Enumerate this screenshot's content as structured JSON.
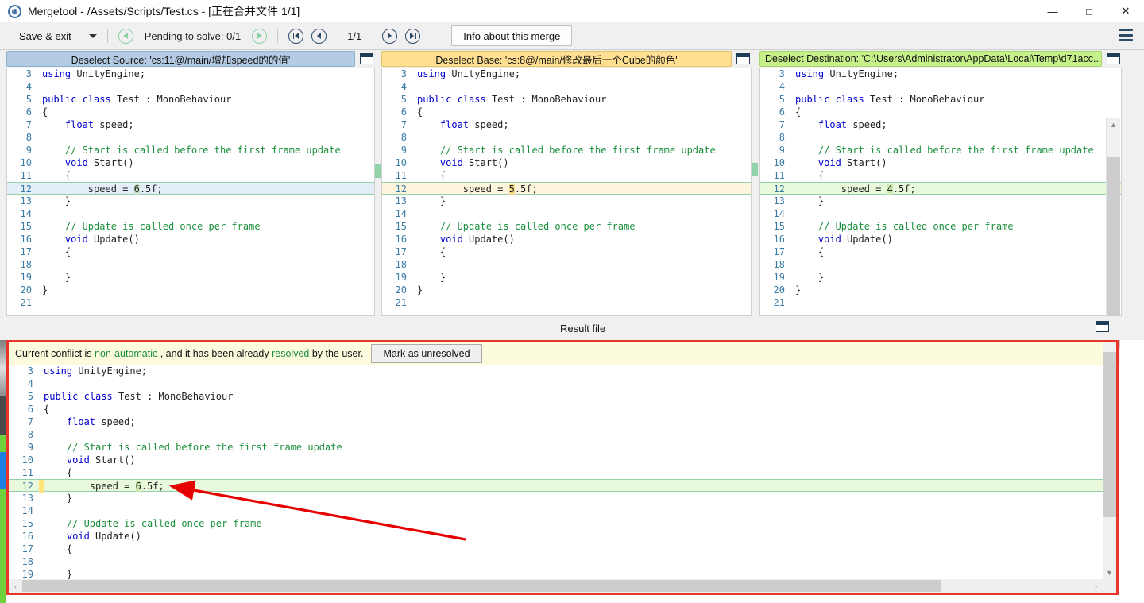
{
  "window": {
    "title": "Mergetool - /Assets/Scripts/Test.cs - [正在合并文件 1/1]",
    "logo_glyph": "◉",
    "minimize": "—",
    "maximize": "□",
    "close": "✕"
  },
  "toolbar": {
    "save_label": "Save & exit",
    "pending_label": "Pending to solve: 0/1",
    "counter": "1/1",
    "info_label": "Info about this merge",
    "prev_conflict_icon": "prev-conflict-icon",
    "next_conflict_icon": "next-conflict-icon",
    "first_file_icon": "first-file-icon",
    "prev_file_icon": "prev-file-icon",
    "next_file_icon": "next-file-icon",
    "last_file_icon": "last-file-icon",
    "menu_icon": "hamburger-menu-icon"
  },
  "panes": [
    {
      "id": "source",
      "title": "Deselect Source: 'cs:11@/main/增加speed的的值'",
      "accent": "#b4cbe3",
      "lines": [
        {
          "n": "3",
          "text": "using UnityEngine;",
          "hl": ""
        },
        {
          "n": "4",
          "text": "",
          "hl": ""
        },
        {
          "n": "5",
          "text": "public class Test : MonoBehaviour",
          "hl": ""
        },
        {
          "n": "6",
          "text": "{",
          "hl": ""
        },
        {
          "n": "7",
          "text": "    float speed;",
          "hl": ""
        },
        {
          "n": "8",
          "text": "",
          "hl": ""
        },
        {
          "n": "9",
          "text": "    // Start is called before the first frame update",
          "hl": ""
        },
        {
          "n": "10",
          "text": "    void Start()",
          "hl": ""
        },
        {
          "n": "11",
          "text": "    {",
          "hl": ""
        },
        {
          "n": "12",
          "text": "        speed = 6.5f;",
          "hl": "blue"
        },
        {
          "n": "13",
          "text": "    }",
          "hl": ""
        },
        {
          "n": "14",
          "text": "",
          "hl": ""
        },
        {
          "n": "15",
          "text": "    // Update is called once per frame",
          "hl": ""
        },
        {
          "n": "16",
          "text": "    void Update()",
          "hl": ""
        },
        {
          "n": "17",
          "text": "    {",
          "hl": ""
        },
        {
          "n": "18",
          "text": "",
          "hl": ""
        },
        {
          "n": "19",
          "text": "    }",
          "hl": ""
        },
        {
          "n": "20",
          "text": "}",
          "hl": ""
        },
        {
          "n": "21",
          "text": "",
          "hl": ""
        }
      ]
    },
    {
      "id": "base",
      "title": "Deselect Base: 'cs:8@/main/修改最后一个Cube的颜色'",
      "accent": "#ffdf92",
      "lines": [
        {
          "n": "3",
          "text": "using UnityEngine;",
          "hl": ""
        },
        {
          "n": "4",
          "text": "",
          "hl": ""
        },
        {
          "n": "5",
          "text": "public class Test : MonoBehaviour",
          "hl": ""
        },
        {
          "n": "6",
          "text": "{",
          "hl": ""
        },
        {
          "n": "7",
          "text": "    float speed;",
          "hl": ""
        },
        {
          "n": "8",
          "text": "",
          "hl": ""
        },
        {
          "n": "9",
          "text": "    // Start is called before the first frame update",
          "hl": ""
        },
        {
          "n": "10",
          "text": "    void Start()",
          "hl": ""
        },
        {
          "n": "11",
          "text": "    {",
          "hl": ""
        },
        {
          "n": "12",
          "text": "        speed = 5.5f;",
          "hl": "yellow"
        },
        {
          "n": "13",
          "text": "    }",
          "hl": ""
        },
        {
          "n": "14",
          "text": "",
          "hl": ""
        },
        {
          "n": "15",
          "text": "    // Update is called once per frame",
          "hl": ""
        },
        {
          "n": "16",
          "text": "    void Update()",
          "hl": ""
        },
        {
          "n": "17",
          "text": "    {",
          "hl": ""
        },
        {
          "n": "18",
          "text": "",
          "hl": ""
        },
        {
          "n": "19",
          "text": "    }",
          "hl": ""
        },
        {
          "n": "20",
          "text": "}",
          "hl": ""
        },
        {
          "n": "21",
          "text": "",
          "hl": ""
        }
      ]
    },
    {
      "id": "destination",
      "title": "Deselect Destination: 'C:\\Users\\Administrator\\AppData\\Local\\Temp\\d71acc...",
      "accent": "#c6f08a",
      "lines": [
        {
          "n": "3",
          "text": "using UnityEngine;",
          "hl": ""
        },
        {
          "n": "4",
          "text": "",
          "hl": ""
        },
        {
          "n": "5",
          "text": "public class Test : MonoBehaviour",
          "hl": ""
        },
        {
          "n": "6",
          "text": "{",
          "hl": ""
        },
        {
          "n": "7",
          "text": "    float speed;",
          "hl": ""
        },
        {
          "n": "8",
          "text": "",
          "hl": ""
        },
        {
          "n": "9",
          "text": "    // Start is called before the first frame update",
          "hl": ""
        },
        {
          "n": "10",
          "text": "    void Start()",
          "hl": ""
        },
        {
          "n": "11",
          "text": "    {",
          "hl": ""
        },
        {
          "n": "12",
          "text": "        speed = 4.5f;",
          "hl": "green"
        },
        {
          "n": "13",
          "text": "    }",
          "hl": ""
        },
        {
          "n": "14",
          "text": "",
          "hl": ""
        },
        {
          "n": "15",
          "text": "    // Update is called once per frame",
          "hl": ""
        },
        {
          "n": "16",
          "text": "    void Update()",
          "hl": ""
        },
        {
          "n": "17",
          "text": "    {",
          "hl": ""
        },
        {
          "n": "18",
          "text": "",
          "hl": ""
        },
        {
          "n": "19",
          "text": "    }",
          "hl": ""
        },
        {
          "n": "20",
          "text": "}",
          "hl": ""
        },
        {
          "n": "21",
          "text": "",
          "hl": ""
        }
      ]
    }
  ],
  "result": {
    "label": "Result file",
    "conflict_prefix": "Current conflict is ",
    "conflict_kind": "non-automatic",
    "conflict_middle": " , and it has been already ",
    "conflict_state": "resolved",
    "conflict_suffix": " by the user.",
    "mark_button": "Mark as unresolved",
    "lines": [
      {
        "n": "3",
        "text": "using UnityEngine;",
        "hl": ""
      },
      {
        "n": "4",
        "text": "",
        "hl": ""
      },
      {
        "n": "5",
        "text": "public class Test : MonoBehaviour",
        "hl": ""
      },
      {
        "n": "6",
        "text": "{",
        "hl": ""
      },
      {
        "n": "7",
        "text": "    float speed;",
        "hl": ""
      },
      {
        "n": "8",
        "text": "",
        "hl": ""
      },
      {
        "n": "9",
        "text": "    // Start is called before the first frame update",
        "hl": ""
      },
      {
        "n": "10",
        "text": "    void Start()",
        "hl": ""
      },
      {
        "n": "11",
        "text": "    {",
        "hl": ""
      },
      {
        "n": "12",
        "text": "        speed = 6.5f;",
        "hl": "green"
      },
      {
        "n": "13",
        "text": "    }",
        "hl": ""
      },
      {
        "n": "14",
        "text": "",
        "hl": ""
      },
      {
        "n": "15",
        "text": "    // Update is called once per frame",
        "hl": ""
      },
      {
        "n": "16",
        "text": "    void Update()",
        "hl": ""
      },
      {
        "n": "17",
        "text": "    {",
        "hl": ""
      },
      {
        "n": "18",
        "text": "",
        "hl": ""
      },
      {
        "n": "19",
        "text": "    }",
        "hl": ""
      }
    ]
  },
  "colors": {
    "source": "#b4cbe3",
    "base": "#ffdf92",
    "destination": "#c6f08a",
    "conflict_frame": "#e8352a",
    "annotation_arrow": "#e60000",
    "keyword": "#0000d0",
    "comment": "#1a8f3c",
    "gutter": "#3a7ca5"
  }
}
